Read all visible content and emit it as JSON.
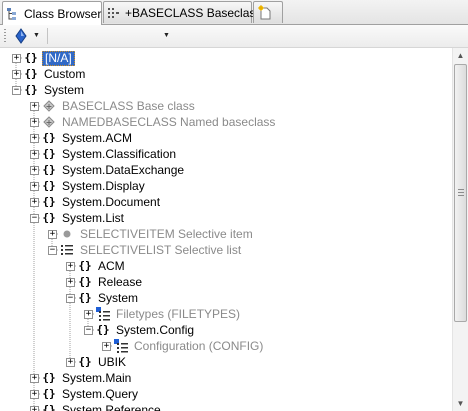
{
  "tabs": [
    {
      "label": "Class Browser",
      "icon": "class-browser-icon",
      "active": true
    },
    {
      "label": "+BASECLASS Baseclass",
      "icon": "class-grid-icon",
      "active": false
    },
    {
      "label": "",
      "icon": "new-document-icon",
      "active": false
    }
  ],
  "toolbar": {
    "filter_icon": "diamond-filter-icon",
    "combo_value": ""
  },
  "tree": {
    "nodes": [
      {
        "label": "[N/A]",
        "icon": "namespace-icon",
        "state": "collapsed",
        "selected": true,
        "gray": false
      },
      {
        "label": "Custom",
        "icon": "namespace-icon",
        "state": "collapsed",
        "gray": false
      },
      {
        "label": "System",
        "icon": "namespace-icon",
        "state": "expanded",
        "gray": false
      },
      {
        "label": "BASECLASS Base class",
        "icon": "baseclass-icon",
        "state": "collapsed",
        "gray": true
      },
      {
        "label": "NAMEDBASECLASS Named baseclass",
        "icon": "baseclass-icon",
        "state": "collapsed",
        "gray": true
      },
      {
        "label": "System.ACM",
        "icon": "namespace-icon",
        "state": "collapsed",
        "gray": false
      },
      {
        "label": "System.Classification",
        "icon": "namespace-icon",
        "state": "collapsed",
        "gray": false
      },
      {
        "label": "System.DataExchange",
        "icon": "namespace-icon",
        "state": "collapsed",
        "gray": false
      },
      {
        "label": "System.Display",
        "icon": "namespace-icon",
        "state": "collapsed",
        "gray": false
      },
      {
        "label": "System.Document",
        "icon": "namespace-icon",
        "state": "collapsed",
        "gray": false
      },
      {
        "label": "System.List",
        "icon": "namespace-icon",
        "state": "expanded",
        "gray": false
      },
      {
        "label": "SELECTIVEITEM Selective item",
        "icon": "item-icon",
        "state": "collapsed",
        "gray": true
      },
      {
        "label": "SELECTIVELIST Selective list",
        "icon": "list-icon",
        "state": "expanded",
        "gray": true
      },
      {
        "label": "ACM",
        "icon": "namespace-icon",
        "state": "collapsed",
        "gray": false
      },
      {
        "label": "Release",
        "icon": "namespace-icon",
        "state": "collapsed",
        "gray": false
      },
      {
        "label": "System",
        "icon": "namespace-icon",
        "state": "expanded",
        "gray": false
      },
      {
        "label": "Filetypes (FILETYPES)",
        "icon": "list-instance-icon",
        "state": "collapsed",
        "gray": true
      },
      {
        "label": "System.Config",
        "icon": "namespace-icon",
        "state": "expanded",
        "gray": false
      },
      {
        "label": "Configuration (CONFIG)",
        "icon": "list-instance-icon",
        "state": "collapsed",
        "gray": true
      },
      {
        "label": "UBIK",
        "icon": "namespace-icon",
        "state": "collapsed",
        "gray": false
      },
      {
        "label": "System.Main",
        "icon": "namespace-icon",
        "state": "collapsed",
        "gray": false
      },
      {
        "label": "System.Query",
        "icon": "namespace-icon",
        "state": "collapsed",
        "gray": false
      },
      {
        "label": "System.Reference",
        "icon": "namespace-icon",
        "state": "collapsed",
        "gray": false
      }
    ]
  },
  "scrollbar": {
    "up_icon": "scroll-up-icon",
    "down_icon": "scroll-down-icon"
  },
  "colors": {
    "selection": "#3169c6",
    "muted_text": "#8a8a8a",
    "accent_blue": "#1f5fd6"
  }
}
